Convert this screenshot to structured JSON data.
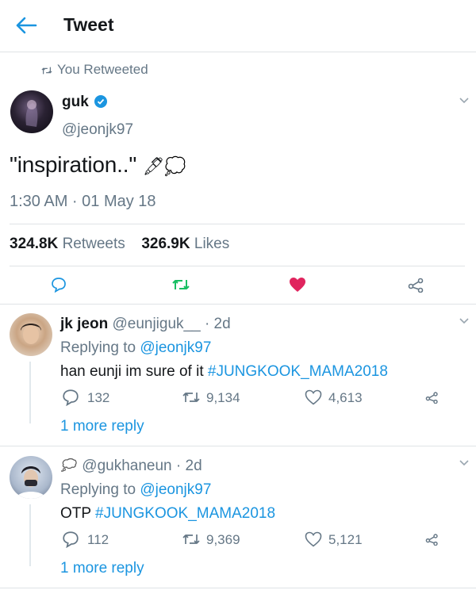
{
  "header": {
    "title": "Tweet"
  },
  "retweet_notice": "You Retweeted",
  "tweet": {
    "name": "guk",
    "handle": "@jeonjk97",
    "text": "\"inspiration..\"",
    "emoji": "🖋💭",
    "time": "1:30 AM · 01 May 18",
    "retweets_count": "324.8K",
    "retweets_label": "Retweets",
    "likes_count": "326.9K",
    "likes_label": "Likes",
    "liked": true
  },
  "replies": [
    {
      "name": "jk jeon",
      "handle": "@eunjiguk__",
      "age": "· 2d",
      "replying_prefix": "Replying to",
      "replying_to": "@jeonjk97",
      "text": "han eunji im sure of it",
      "hashtag": "#JUNGKOOK_MAMA2018",
      "replies": "132",
      "retweets": "9,134",
      "likes": "4,613",
      "more": "1 more reply"
    },
    {
      "name_icon": "thought-balloon-emoji",
      "handle": "@gukhaneun",
      "age": "· 2d",
      "replying_prefix": "Replying to",
      "replying_to": "@jeonjk97",
      "text": "OTP",
      "hashtag": "#JUNGKOOK_MAMA2018",
      "replies": "112",
      "retweets": "9,369",
      "likes": "5,121",
      "more": "1 more reply"
    }
  ],
  "colors": {
    "accent": "#1b95e0",
    "retweet_green": "#17bf63",
    "like_red": "#e0245e",
    "text_gray": "#657786"
  }
}
